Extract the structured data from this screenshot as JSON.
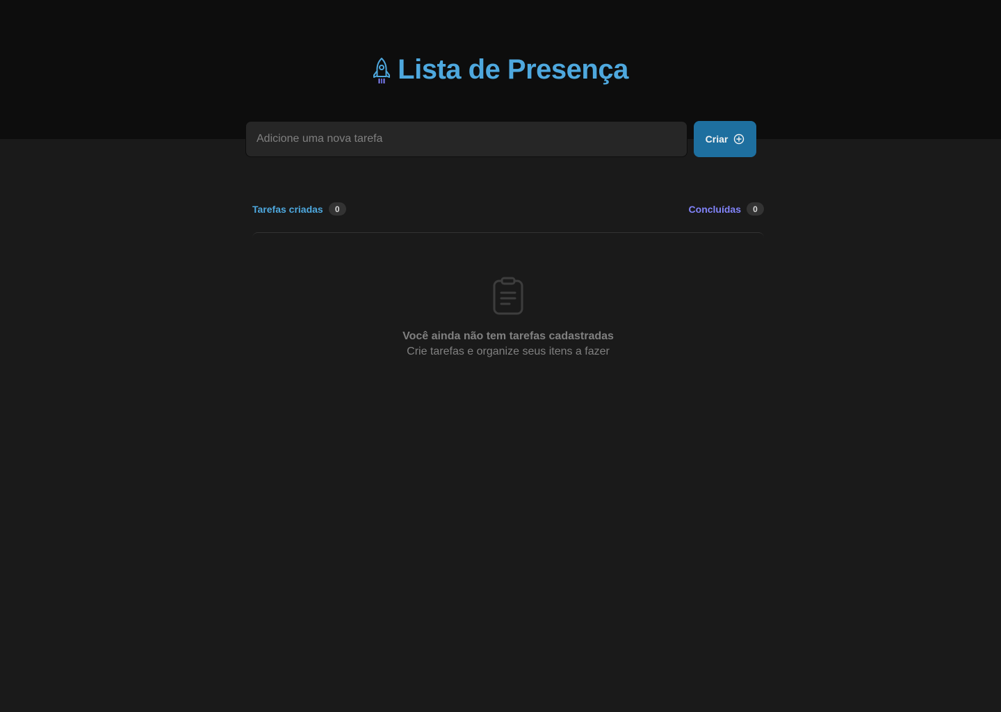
{
  "header": {
    "title": "Lista de Presença",
    "logo_icon": "rocket-icon"
  },
  "new_task": {
    "placeholder": "Adicione uma nova tarefa",
    "value": "",
    "create_label": "Criar",
    "create_icon": "plus-circle-icon"
  },
  "stats": {
    "created_label": "Tarefas criadas",
    "created_count": "0",
    "done_label": "Concluídas",
    "done_count": "0"
  },
  "empty_state": {
    "icon": "clipboard-icon",
    "title": "Você ainda não tem tarefas cadastradas",
    "subtitle": "Crie tarefas e organize seus itens a fazer"
  },
  "colors": {
    "header_bg": "#0d0d0d",
    "page_bg": "#1a1a1a",
    "brand_blue": "#4ea8de",
    "brand_purple": "#8284fa",
    "button_blue": "#1e6f9f",
    "input_bg": "#262626",
    "muted_text": "#808080",
    "badge_bg": "#333333"
  }
}
